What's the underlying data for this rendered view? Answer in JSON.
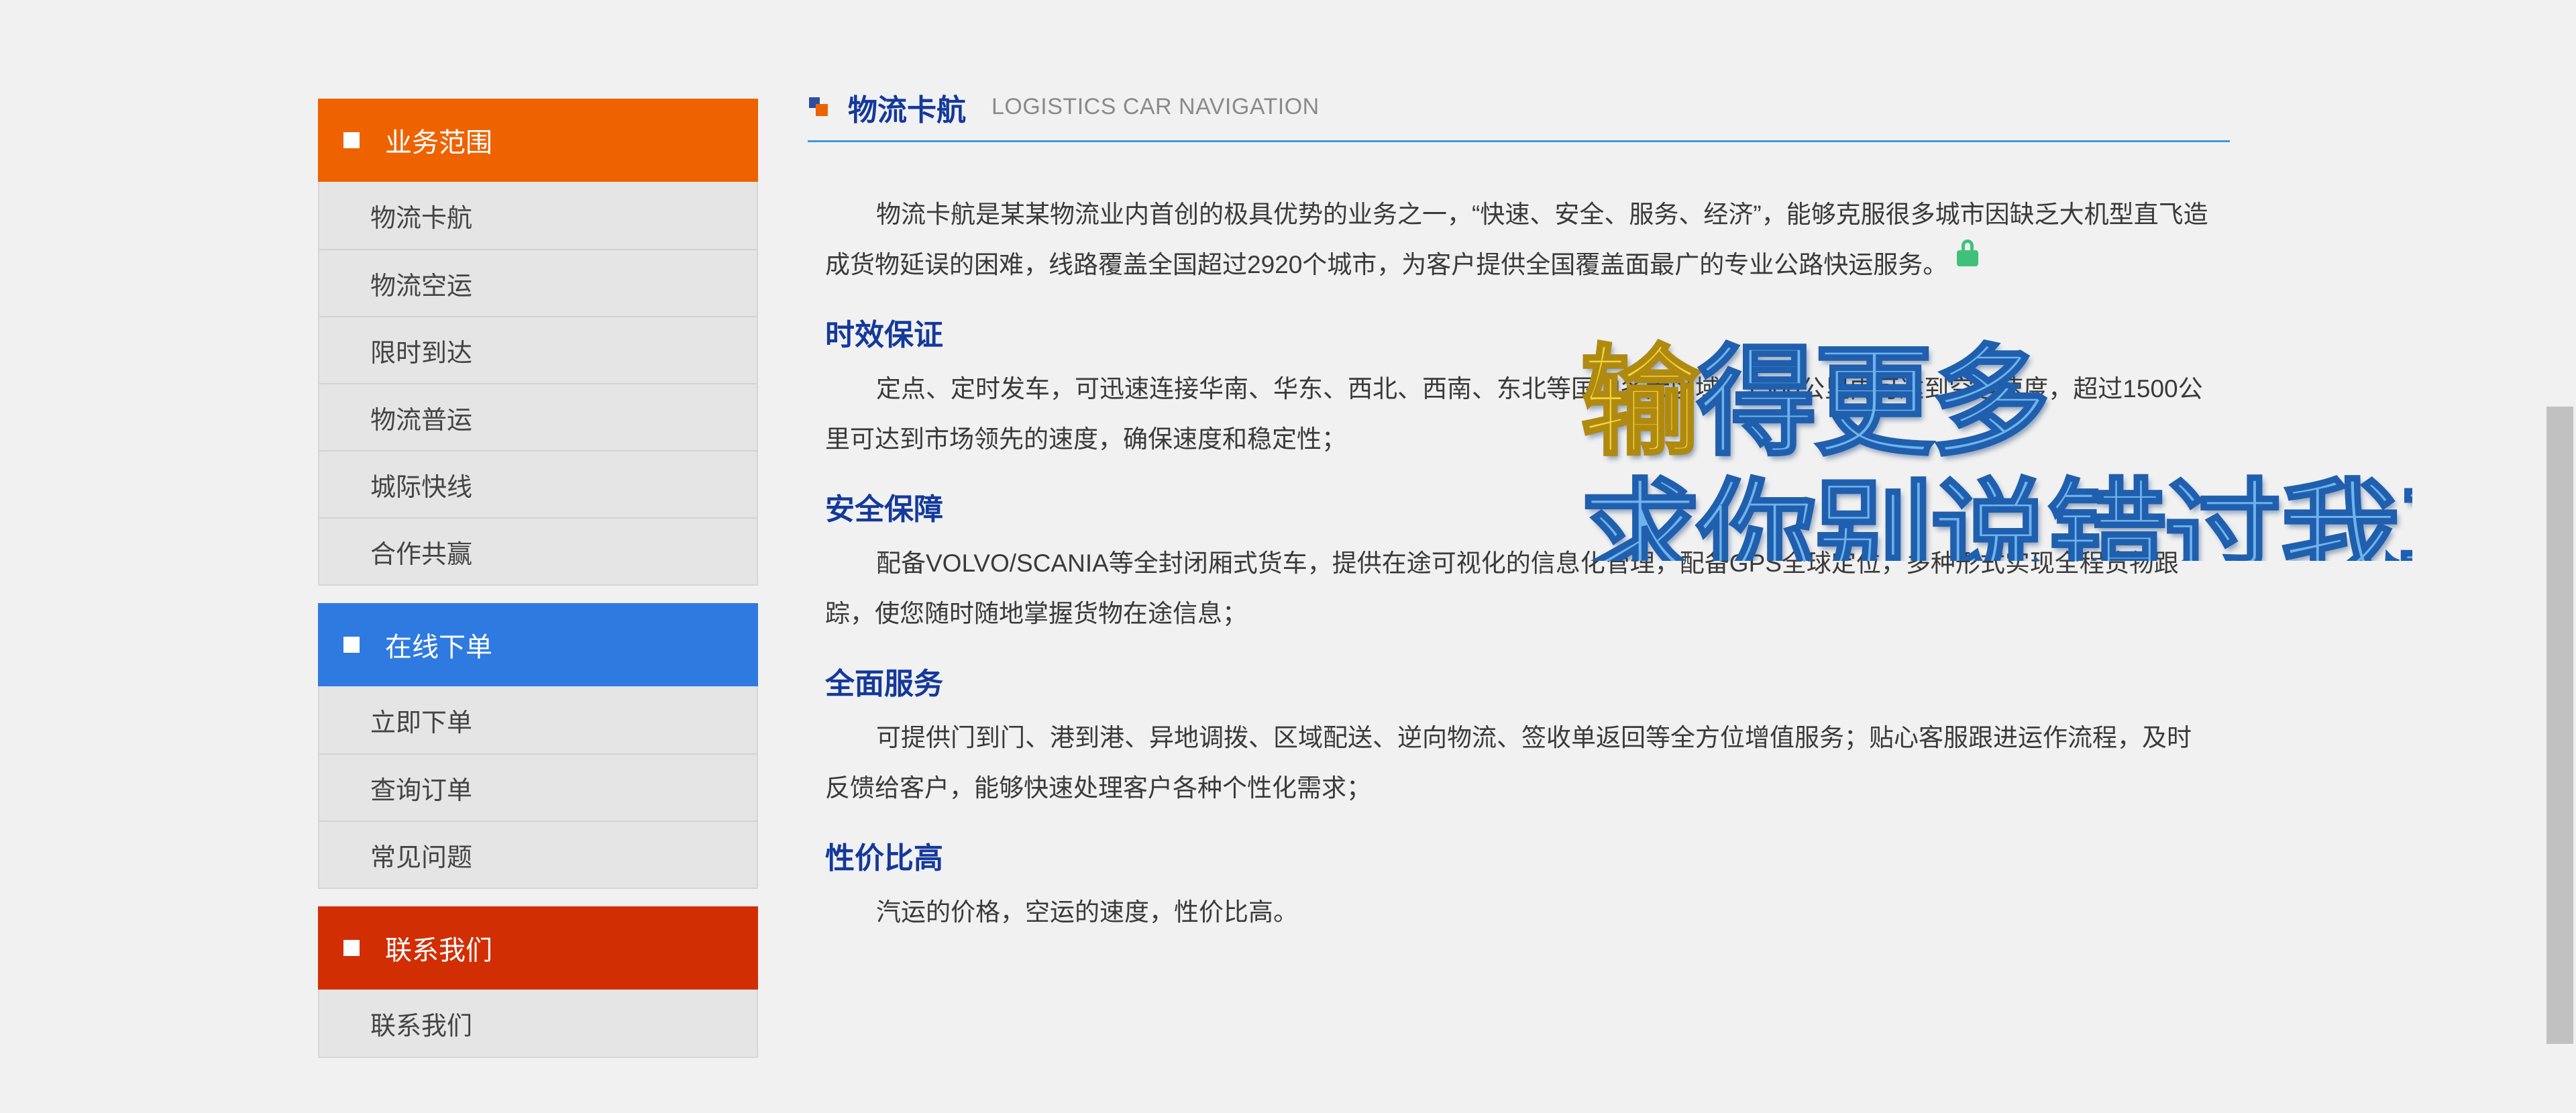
{
  "sidebar": {
    "groups": [
      {
        "title": "业务范围",
        "color": "#ee6200",
        "items": [
          "物流卡航",
          "物流空运",
          "限时到达",
          "物流普运",
          "城际快线",
          "合作共赢"
        ]
      },
      {
        "title": "在线下单",
        "color": "#2e7ae0",
        "items": [
          "立即下单",
          "查询订单",
          "常见问题"
        ]
      },
      {
        "title": "联系我们",
        "color": "#d22e04",
        "items": [
          "联系我们"
        ]
      }
    ]
  },
  "main": {
    "title_cn": "物流卡航",
    "title_en": "LOGISTICS CAR NAVIGATION",
    "intro": "物流卡航是某某物流业内首创的极具优势的业务之一，“快速、安全、服务、经济”，能够克服很多城市因缺乏大机型直飞造成货物延误的困难，线路覆盖全国超过2920个城市，为客户提供全国覆盖面最广的专业公路快运服务。",
    "sections": [
      {
        "heading": "时效保证",
        "text": "定点、定时发车，可迅速连接华南、华东、西北、西南、东北等国内各大区域，1500公里内可达到空运速度，超过1500公里可达到市场领先的速度，确保速度和稳定性；"
      },
      {
        "heading": "安全保障",
        "text": "配备VOLVO/SCANIA等全封闭厢式货车，提供在途可视化的信息化管理，配备GPS全球定位，多种形式实现全程货物跟踪，使您随时随地掌握货物在途信息；"
      },
      {
        "heading": "全面服务",
        "text": "可提供门到门、港到港、异地调拨、区域配送、逆向物流、签收单返回等全方位增值服务；贴心客服跟进运作流程，及时反馈给客户，能够快速处理客户各种个性化需求；"
      },
      {
        "heading": "性价比高",
        "text": "汽运的价格，空运的速度，性价比高。"
      }
    ]
  },
  "overlay": {
    "line1_highlight": "输",
    "line1_rest": "得更多",
    "line2": "求你别说错过我其实"
  },
  "colors": {
    "title_blue": "#14399b",
    "accent_line": "#3a9cd6",
    "lock_green": "#3ec27a"
  },
  "icons": [
    "title-square-icon",
    "bullet-square-icon",
    "lock-icon"
  ]
}
